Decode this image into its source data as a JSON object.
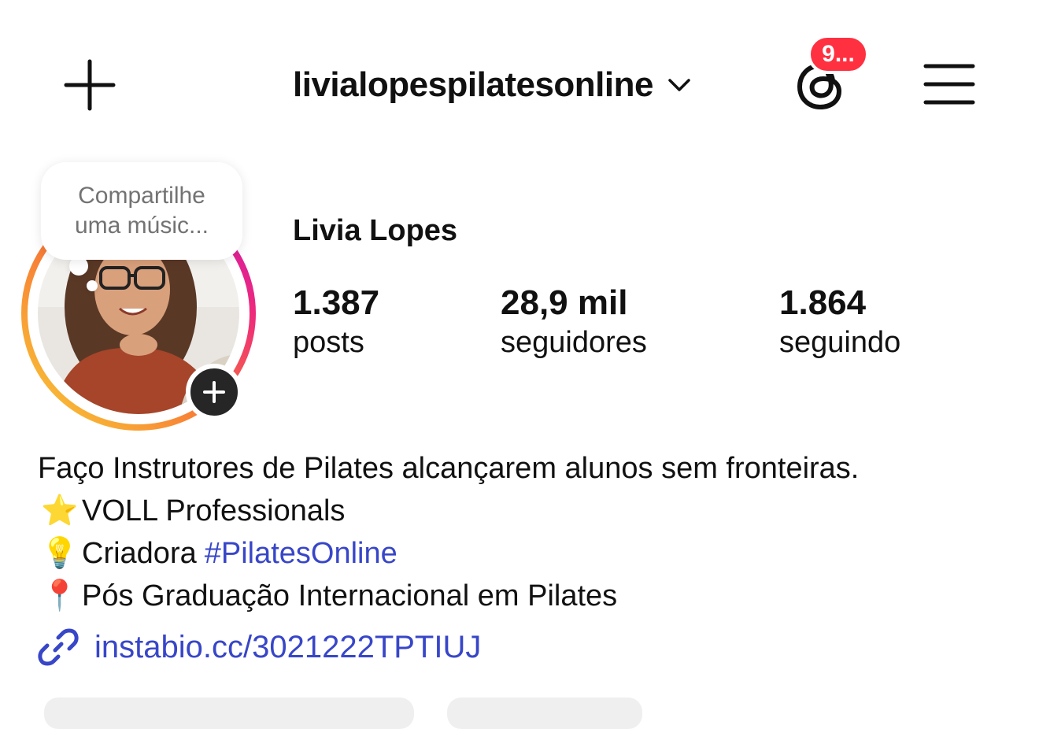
{
  "header": {
    "username": "livialopespilatesonline",
    "notification_badge": "9...",
    "badge_color": "#ff3040"
  },
  "profile": {
    "display_name": "Livia Lopes",
    "note": {
      "line1": "Compartilhe",
      "line2": "uma músic..."
    },
    "stats": {
      "posts": {
        "value": "1.387",
        "label": "posts"
      },
      "followers": {
        "value": "28,9 mil",
        "label": "seguidores"
      },
      "following": {
        "value": "1.864",
        "label": "seguindo"
      }
    }
  },
  "bio": {
    "line1": "Faço Instrutores de Pilates alcançarem alunos sem fronteiras.",
    "line2": {
      "emoji": "⭐",
      "text": "VOLL Professionals"
    },
    "line3": {
      "emoji": "💡",
      "text": "Criadora",
      "hashtag": "#PilatesOnline"
    },
    "line4": {
      "emoji": "📍",
      "text": "Pós Graduação Internacional em Pilates"
    }
  },
  "link": {
    "icon": "link-icon",
    "text": "instabio.cc/3021222TPTIUJ"
  },
  "colors": {
    "link": "#3846c8",
    "ring_start": "#f9ce34",
    "ring_mid": "#ee2a7b",
    "ring_end": "#c913b9"
  }
}
